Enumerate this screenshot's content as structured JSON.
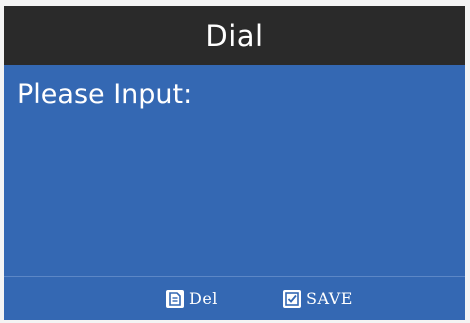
{
  "header": {
    "title": "Dial"
  },
  "main": {
    "prompt": "Please Input:",
    "input_value": ""
  },
  "softkeys": {
    "del": {
      "label": "Del",
      "icon": "delete-doc-icon"
    },
    "save": {
      "label": "SAVE",
      "icon": "checkbox-icon"
    }
  },
  "colors": {
    "screen_background": "#3468b3",
    "title_bar": "#2a2a2a",
    "text": "#ffffff"
  }
}
